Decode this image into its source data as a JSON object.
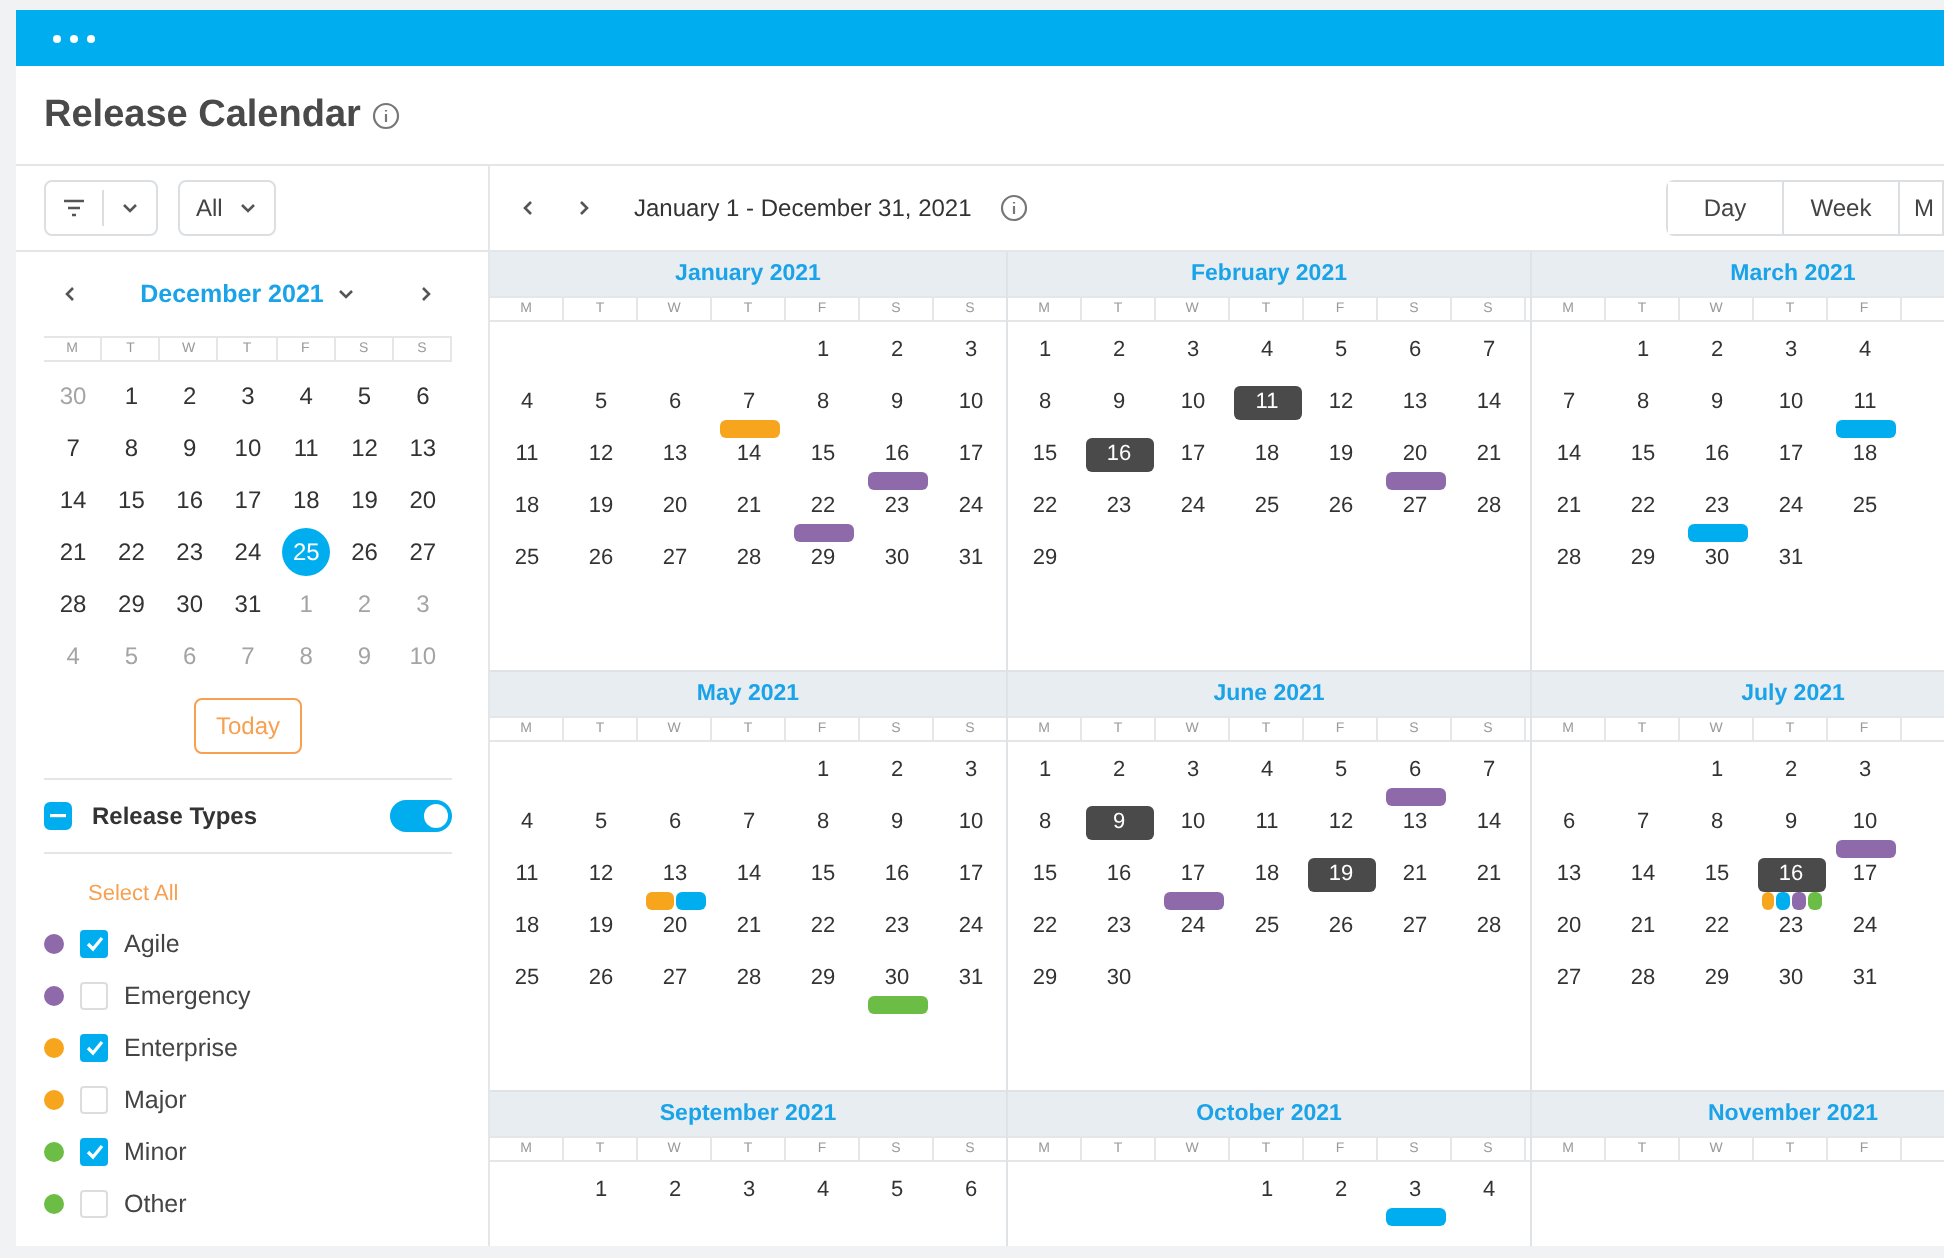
{
  "page": {
    "title": "Release Calendar"
  },
  "sidebar": {
    "scope_dropdown": {
      "value": "All"
    },
    "mini_calendar": {
      "title": "December 2021",
      "weekdays": [
        "M",
        "T",
        "W",
        "T",
        "F",
        "S",
        "S"
      ],
      "days": [
        {
          "day": "30",
          "muted": true,
          "selected": false
        },
        {
          "day": "1",
          "muted": false,
          "selected": false
        },
        {
          "day": "2",
          "muted": false,
          "selected": false
        },
        {
          "day": "3",
          "muted": false,
          "selected": false
        },
        {
          "day": "4",
          "muted": false,
          "selected": false
        },
        {
          "day": "5",
          "muted": false,
          "selected": false
        },
        {
          "day": "6",
          "muted": false,
          "selected": false
        },
        {
          "day": "7",
          "muted": false,
          "selected": false
        },
        {
          "day": "8",
          "muted": false,
          "selected": false
        },
        {
          "day": "9",
          "muted": false,
          "selected": false
        },
        {
          "day": "10",
          "muted": false,
          "selected": false
        },
        {
          "day": "11",
          "muted": false,
          "selected": false
        },
        {
          "day": "12",
          "muted": false,
          "selected": false
        },
        {
          "day": "13",
          "muted": false,
          "selected": false
        },
        {
          "day": "14",
          "muted": false,
          "selected": false
        },
        {
          "day": "15",
          "muted": false,
          "selected": false
        },
        {
          "day": "16",
          "muted": false,
          "selected": false
        },
        {
          "day": "17",
          "muted": false,
          "selected": false
        },
        {
          "day": "18",
          "muted": false,
          "selected": false
        },
        {
          "day": "19",
          "muted": false,
          "selected": false
        },
        {
          "day": "20",
          "muted": false,
          "selected": false
        },
        {
          "day": "21",
          "muted": false,
          "selected": false
        },
        {
          "day": "22",
          "muted": false,
          "selected": false
        },
        {
          "day": "23",
          "muted": false,
          "selected": false
        },
        {
          "day": "24",
          "muted": false,
          "selected": false
        },
        {
          "day": "25",
          "muted": false,
          "selected": true
        },
        {
          "day": "26",
          "muted": false,
          "selected": false
        },
        {
          "day": "27",
          "muted": false,
          "selected": false
        },
        {
          "day": "28",
          "muted": false,
          "selected": false
        },
        {
          "day": "29",
          "muted": false,
          "selected": false
        },
        {
          "day": "30",
          "muted": false,
          "selected": false
        },
        {
          "day": "31",
          "muted": false,
          "selected": false
        },
        {
          "day": "1",
          "muted": true,
          "selected": false
        },
        {
          "day": "2",
          "muted": true,
          "selected": false
        },
        {
          "day": "3",
          "muted": true,
          "selected": false
        },
        {
          "day": "4",
          "muted": true,
          "selected": false
        },
        {
          "day": "5",
          "muted": true,
          "selected": false
        },
        {
          "day": "6",
          "muted": true,
          "selected": false
        },
        {
          "day": "7",
          "muted": true,
          "selected": false
        },
        {
          "day": "8",
          "muted": true,
          "selected": false
        },
        {
          "day": "9",
          "muted": true,
          "selected": false
        },
        {
          "day": "10",
          "muted": true,
          "selected": false
        }
      ]
    },
    "today_button": "Today",
    "release_types": {
      "label": "Release Types",
      "indeterminate": true,
      "on": true,
      "select_all": "Select All",
      "items": [
        {
          "label": "Agile",
          "color": "#8e6aab",
          "checked": true
        },
        {
          "label": "Emergency",
          "color": "#8e6aab",
          "checked": false
        },
        {
          "label": "Enterprise",
          "color": "#f7a51c",
          "checked": true
        },
        {
          "label": "Major",
          "color": "#f7a51c",
          "checked": false
        },
        {
          "label": "Minor",
          "color": "#6cbd45",
          "checked": true
        },
        {
          "label": "Other",
          "color": "#6cbd45",
          "checked": false
        }
      ]
    }
  },
  "calendar": {
    "range": "January 1 - December 31, 2021",
    "views": [
      "Day",
      "Week",
      "M"
    ],
    "months": [
      {
        "title": "January 2021",
        "weekdays": [
          "M",
          "T",
          "W",
          "T",
          "F",
          "S",
          "S"
        ],
        "weeks": [
          {
            "right_aligned": true,
            "days": [
              "1",
              "2",
              "3"
            ]
          },
          [
            "4",
            "5",
            "6",
            {
              "day": "7",
              "highlighted": false,
              "events": [
                {
                  "color": "#f7a51c"
                }
              ]
            },
            "8",
            "9",
            "10"
          ],
          [
            "11",
            "12",
            "13",
            "14",
            "15",
            {
              "day": "16",
              "highlighted": false,
              "events": [
                {
                  "color": "#8e6aab"
                }
              ]
            },
            "17"
          ],
          [
            "18",
            "19",
            "20",
            "21",
            {
              "day": "22",
              "highlighted": false,
              "events": [
                {
                  "color": "#8e6aab"
                }
              ]
            },
            "23",
            "24"
          ],
          [
            "25",
            "26",
            "27",
            "28",
            "29",
            "30",
            "31"
          ]
        ]
      },
      {
        "title": "February 2021",
        "weekdays": [
          "M",
          "T",
          "W",
          "T",
          "F",
          "S",
          "S"
        ],
        "weeks": [
          [
            "1",
            "2",
            "3",
            "4",
            "5",
            "6",
            "7"
          ],
          [
            "8",
            "9",
            "10",
            {
              "day": "11",
              "highlighted": true
            },
            "12",
            "13",
            "14"
          ],
          [
            "15",
            {
              "day": "16",
              "highlighted": true
            },
            "17",
            "18",
            "19",
            {
              "day": "20",
              "highlighted": false,
              "events": [
                {
                  "color": "#8e6aab"
                }
              ]
            },
            "21"
          ],
          [
            "22",
            "23",
            "24",
            "25",
            "26",
            "27",
            "28"
          ],
          [
            "29"
          ]
        ]
      },
      {
        "title": "March 2021",
        "weekdays": [
          "M",
          "T",
          "W",
          "T",
          "F"
        ],
        "weeks": [
          {
            "right_aligned": true,
            "days": [
              "1",
              "2",
              "3",
              "4"
            ]
          },
          [
            "7",
            "8",
            "9",
            "10",
            {
              "day": "11",
              "highlighted": false,
              "events": [
                {
                  "color": "#00aeef"
                }
              ]
            }
          ],
          [
            "14",
            "15",
            "16",
            "17",
            "18"
          ],
          [
            "21",
            "22",
            {
              "day": "23",
              "highlighted": false,
              "events": [
                {
                  "color": "#00aeef"
                }
              ]
            },
            "24",
            "25"
          ],
          [
            "28",
            "29",
            "30",
            "31"
          ]
        ]
      },
      {
        "title": "May 2021",
        "weekdays": [
          "M",
          "T",
          "W",
          "T",
          "F",
          "S",
          "S"
        ],
        "weeks": [
          {
            "right_aligned": true,
            "days": [
              "1",
              "2",
              "3"
            ]
          },
          [
            "4",
            "5",
            "6",
            "7",
            "8",
            "9",
            "10"
          ],
          [
            "11",
            "12",
            {
              "day": "13",
              "highlighted": false,
              "events": [
                {
                  "color": "#f7a51c"
                },
                {
                  "color": "#00aeef"
                }
              ]
            },
            "14",
            "15",
            "16",
            "17"
          ],
          [
            "18",
            "19",
            "20",
            "21",
            "22",
            "23",
            "24"
          ],
          [
            "25",
            "26",
            "27",
            "28",
            "29",
            {
              "day": "30",
              "highlighted": false,
              "events": [
                {
                  "color": "#6cbd45"
                }
              ]
            },
            "31"
          ]
        ]
      },
      {
        "title": "June 2021",
        "weekdays": [
          "M",
          "T",
          "W",
          "T",
          "F",
          "S",
          "S"
        ],
        "weeks": [
          [
            "1",
            "2",
            "3",
            "4",
            "5",
            {
              "day": "6",
              "highlighted": false,
              "events": [
                {
                  "color": "#8e6aab"
                }
              ]
            },
            "7"
          ],
          [
            "8",
            {
              "day": "9",
              "highlighted": true
            },
            "10",
            "11",
            "12",
            "13",
            "14"
          ],
          [
            "15",
            "16",
            {
              "day": "17",
              "highlighted": false,
              "events": [
                {
                  "color": "#8e6aab"
                }
              ]
            },
            "18",
            {
              "day": "19",
              "highlighted": true
            },
            "21",
            "21"
          ],
          [
            "22",
            "23",
            "24",
            "25",
            "26",
            "27",
            "28"
          ],
          [
            "29",
            "30"
          ]
        ]
      },
      {
        "title": "July 2021",
        "weekdays": [
          "M",
          "T",
          "W",
          "T",
          "F"
        ],
        "weeks": [
          {
            "right_aligned": true,
            "days": [
              "1",
              "2",
              "3"
            ]
          },
          [
            "6",
            "7",
            "8",
            "9",
            {
              "day": "10",
              "highlighted": false,
              "events": [
                {
                  "color": "#8e6aab"
                }
              ]
            }
          ],
          [
            "13",
            "14",
            "15",
            {
              "day": "16",
              "highlighted": true,
              "events": [
                {
                  "color": "#f7a51c"
                },
                {
                  "color": "#00aeef"
                },
                {
                  "color": "#8e6aab"
                },
                {
                  "color": "#6cbd45"
                }
              ]
            },
            "17"
          ],
          [
            "20",
            "21",
            "22",
            "23",
            "24"
          ],
          [
            "27",
            "28",
            "29",
            "30",
            "31"
          ]
        ]
      },
      {
        "title": "September 2021",
        "weekdays": [
          "M",
          "T",
          "W",
          "T",
          "F",
          "S",
          "S"
        ],
        "weeks": [
          {
            "right_aligned": true,
            "days": [
              "1",
              "2",
              "3",
              "4",
              "5",
              "6"
            ]
          }
        ]
      },
      {
        "title": "October 2021",
        "weekdays": [
          "M",
          "T",
          "W",
          "T",
          "F",
          "S",
          "S"
        ],
        "weeks": [
          {
            "right_aligned": true,
            "days": [
              "1",
              "2",
              {
                "day": "3",
                "highlighted": false,
                "events": [
                  {
                    "color": "#00aeef"
                  }
                ]
              },
              "4"
            ]
          }
        ]
      },
      {
        "title": "November 2021",
        "weekdays": [
          "M",
          "T",
          "W",
          "T",
          "F"
        ]
      }
    ]
  }
}
